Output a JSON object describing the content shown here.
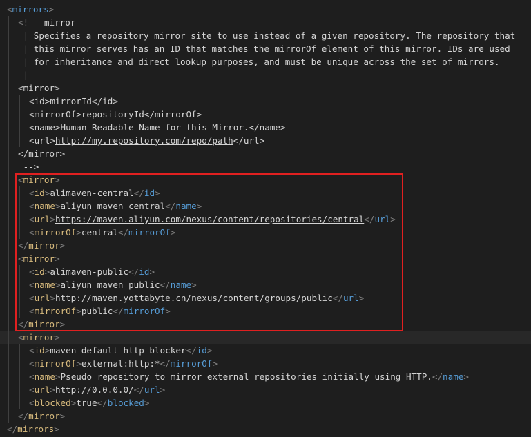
{
  "lines": [
    {
      "indent": 0,
      "tokens": [
        [
          "b",
          "<"
        ],
        [
          "tg",
          "mirrors"
        ],
        [
          "b",
          ">"
        ]
      ]
    },
    {
      "indent": 1,
      "tokens": [
        [
          "b",
          "<!-- "
        ],
        [
          "tx",
          "mirror"
        ]
      ]
    },
    {
      "indent": 1,
      "tokens": [
        [
          "cd",
          " | "
        ],
        [
          "tx",
          "Specifies a repository mirror site to use instead of a given repository. The repository that"
        ]
      ]
    },
    {
      "indent": 1,
      "tokens": [
        [
          "cd",
          " | "
        ],
        [
          "tx",
          "this mirror serves has an ID that matches the mirrorOf element of this mirror. IDs are used"
        ]
      ]
    },
    {
      "indent": 1,
      "tokens": [
        [
          "cd",
          " | "
        ],
        [
          "tx",
          "for inheritance and direct lookup purposes, and must be unique across the set of mirrors."
        ]
      ]
    },
    {
      "indent": 1,
      "tokens": [
        [
          "cd",
          " |"
        ]
      ]
    },
    {
      "indent": 1,
      "tokens": [
        [
          "tx",
          "<mirror>"
        ]
      ]
    },
    {
      "indent": 2,
      "tokens": [
        [
          "tx",
          "<id>mirrorId</id>"
        ]
      ]
    },
    {
      "indent": 2,
      "tokens": [
        [
          "tx",
          "<mirrorOf>repositoryId</mirrorOf>"
        ]
      ]
    },
    {
      "indent": 2,
      "tokens": [
        [
          "tx",
          "<name>Human Readable Name for this Mirror.</name>"
        ]
      ]
    },
    {
      "indent": 2,
      "tokens": [
        [
          "tx",
          "<url>"
        ],
        [
          "ln",
          "http://my.repository.com/repo/path"
        ],
        [
          "tx",
          "</url>"
        ]
      ]
    },
    {
      "indent": 1,
      "tokens": [
        [
          "tx",
          "</mirror>"
        ]
      ]
    },
    {
      "indent": 1,
      "tokens": [
        [
          "tx",
          " -->"
        ]
      ]
    },
    {
      "indent": 1,
      "tokens": [
        [
          "b",
          "<"
        ],
        [
          "tg2",
          "mirror"
        ],
        [
          "b",
          ">"
        ]
      ]
    },
    {
      "indent": 2,
      "tokens": [
        [
          "b",
          "<"
        ],
        [
          "tg2",
          "id"
        ],
        [
          "b",
          ">"
        ],
        [
          "tx",
          "alimaven-central"
        ],
        [
          "b",
          "</"
        ],
        [
          "tg",
          "id"
        ],
        [
          "b",
          ">"
        ]
      ]
    },
    {
      "indent": 2,
      "tokens": [
        [
          "b",
          "<"
        ],
        [
          "tg2",
          "name"
        ],
        [
          "b",
          ">"
        ],
        [
          "tx",
          "aliyun maven central"
        ],
        [
          "b",
          "</"
        ],
        [
          "tg",
          "name"
        ],
        [
          "b",
          ">"
        ]
      ]
    },
    {
      "indent": 2,
      "tokens": [
        [
          "b",
          "<"
        ],
        [
          "tg2",
          "url"
        ],
        [
          "b",
          ">"
        ],
        [
          "ln",
          "https://maven.aliyun.com/nexus/content/repositories/central"
        ],
        [
          "b",
          "</"
        ],
        [
          "tg",
          "url"
        ],
        [
          "b",
          ">"
        ]
      ]
    },
    {
      "indent": 2,
      "tokens": [
        [
          "b",
          "<"
        ],
        [
          "tg2",
          "mirrorOf"
        ],
        [
          "b",
          ">"
        ],
        [
          "tx",
          "central"
        ],
        [
          "b",
          "</"
        ],
        [
          "tg",
          "mirrorOf"
        ],
        [
          "b",
          ">"
        ]
      ]
    },
    {
      "indent": 1,
      "tokens": [
        [
          "b",
          "</"
        ],
        [
          "tg2",
          "mirror"
        ],
        [
          "b",
          ">"
        ]
      ]
    },
    {
      "indent": 1,
      "tokens": [
        [
          "b",
          "<"
        ],
        [
          "tg2",
          "mirror"
        ],
        [
          "b",
          ">"
        ]
      ]
    },
    {
      "indent": 2,
      "tokens": [
        [
          "b",
          "<"
        ],
        [
          "tg2",
          "id"
        ],
        [
          "b",
          ">"
        ],
        [
          "tx",
          "alimaven-public"
        ],
        [
          "b",
          "</"
        ],
        [
          "tg",
          "id"
        ],
        [
          "b",
          ">"
        ]
      ]
    },
    {
      "indent": 2,
      "tokens": [
        [
          "b",
          "<"
        ],
        [
          "tg2",
          "name"
        ],
        [
          "b",
          ">"
        ],
        [
          "tx",
          "aliyun maven public"
        ],
        [
          "b",
          "</"
        ],
        [
          "tg",
          "name"
        ],
        [
          "b",
          ">"
        ]
      ]
    },
    {
      "indent": 2,
      "tokens": [
        [
          "b",
          "<"
        ],
        [
          "tg2",
          "url"
        ],
        [
          "b",
          ">"
        ],
        [
          "ln",
          "http://maven.yottabyte.cn/nexus/content/groups/public"
        ],
        [
          "b",
          "</"
        ],
        [
          "tg",
          "url"
        ],
        [
          "b",
          ">"
        ]
      ]
    },
    {
      "indent": 2,
      "tokens": [
        [
          "b",
          "<"
        ],
        [
          "tg2",
          "mirrorOf"
        ],
        [
          "b",
          ">"
        ],
        [
          "tx",
          "public"
        ],
        [
          "b",
          "</"
        ],
        [
          "tg",
          "mirrorOf"
        ],
        [
          "b",
          ">"
        ]
      ]
    },
    {
      "indent": 1,
      "tokens": [
        [
          "b",
          "</"
        ],
        [
          "tg2",
          "mirror"
        ],
        [
          "b",
          ">"
        ]
      ]
    },
    {
      "indent": 1,
      "tokens": [
        [
          "b",
          "<"
        ],
        [
          "tg2",
          "mirror"
        ],
        [
          "b",
          ">"
        ]
      ],
      "active": true
    },
    {
      "indent": 2,
      "tokens": [
        [
          "b",
          "<"
        ],
        [
          "tg2",
          "id"
        ],
        [
          "b",
          ">"
        ],
        [
          "tx",
          "maven-default-http-blocker"
        ],
        [
          "b",
          "</"
        ],
        [
          "tg",
          "id"
        ],
        [
          "b",
          ">"
        ]
      ]
    },
    {
      "indent": 2,
      "tokens": [
        [
          "b",
          "<"
        ],
        [
          "tg2",
          "mirrorOf"
        ],
        [
          "b",
          ">"
        ],
        [
          "tx",
          "external:http:*"
        ],
        [
          "b",
          "</"
        ],
        [
          "tg",
          "mirrorOf"
        ],
        [
          "b",
          ">"
        ]
      ]
    },
    {
      "indent": 2,
      "tokens": [
        [
          "b",
          "<"
        ],
        [
          "tg2",
          "name"
        ],
        [
          "b",
          ">"
        ],
        [
          "tx",
          "Pseudo repository to mirror external repositories initially using HTTP."
        ],
        [
          "b",
          "</"
        ],
        [
          "tg",
          "name"
        ],
        [
          "b",
          ">"
        ]
      ]
    },
    {
      "indent": 2,
      "tokens": [
        [
          "b",
          "<"
        ],
        [
          "tg2",
          "url"
        ],
        [
          "b",
          ">"
        ],
        [
          "ln",
          "http://0.0.0.0/"
        ],
        [
          "b",
          "</"
        ],
        [
          "tg",
          "url"
        ],
        [
          "b",
          ">"
        ]
      ]
    },
    {
      "indent": 2,
      "tokens": [
        [
          "b",
          "<"
        ],
        [
          "tg2",
          "blocked"
        ],
        [
          "b",
          ">"
        ],
        [
          "tx",
          "true"
        ],
        [
          "b",
          "</"
        ],
        [
          "tg",
          "blocked"
        ],
        [
          "b",
          ">"
        ]
      ]
    },
    {
      "indent": 1,
      "tokens": [
        [
          "b",
          "</"
        ],
        [
          "tg2",
          "mirror"
        ],
        [
          "b",
          ">"
        ]
      ]
    },
    {
      "indent": 0,
      "tokens": [
        [
          "b",
          "</"
        ],
        [
          "tg2",
          "mirrors"
        ],
        [
          "b",
          ">"
        ]
      ]
    }
  ],
  "colors": {
    "background": "#1e1e1e",
    "active_line": "#282828",
    "bracket": "#808080",
    "tag": "#569cd6",
    "tag_highlight": "#d7ba7d",
    "text": "#d4d4d4",
    "comment_bar": "#8a8a8a",
    "highlight_box": "#e02020"
  }
}
